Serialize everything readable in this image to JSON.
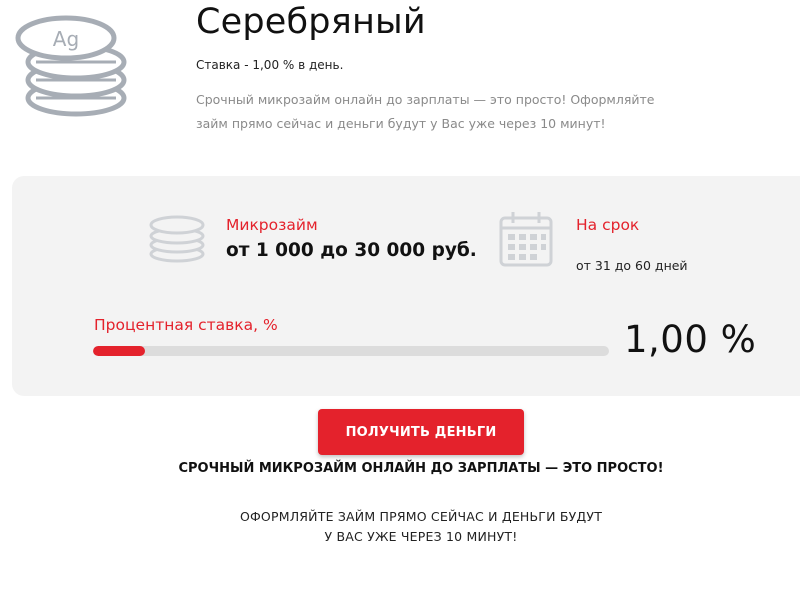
{
  "product": {
    "title": "Серебряный",
    "rate_line": "Ставка - 1,00 % в день.",
    "description": "Срочный микрозайм онлайн до зарплаты — это просто! Оформляйте займ прямо сейчас и деньги будут у Вас уже через 10 минут!",
    "coin_stamp": "Ag"
  },
  "loan": {
    "amount_label": "Микрозайм",
    "amount_value": "от 1 000 до 30 000 руб.",
    "term_label": "На срок",
    "term_value": "от 31 до 60 дней"
  },
  "rate": {
    "label": "Процентная ставка, %",
    "value": "1,00 %",
    "bar_fill_fraction": 0.1
  },
  "cta": {
    "button_label": "ПОЛУЧИТЬ ДЕНЬГИ",
    "tagline": "СРОЧНЫЙ МИКРОЗАЙМ ОНЛАЙН ДО ЗАРПЛАТЫ — ЭТО ПРОСТО!",
    "note_line1": "ОФОРМЛЯЙТЕ ЗАЙМ ПРЯМО СЕЙЧАС И ДЕНЬГИ БУДУТ",
    "note_line2": "У ВАС УЖЕ ЧЕРЕЗ 10 МИНУТ!"
  },
  "icons": {
    "coins_large": "silver-coins-icon",
    "coins_small": "coins-stack-icon",
    "calendar": "calendar-icon"
  },
  "colors": {
    "accent": "#e4222c",
    "panel_bg": "#f3f3f3",
    "icon_gray": "#a7adb5"
  }
}
